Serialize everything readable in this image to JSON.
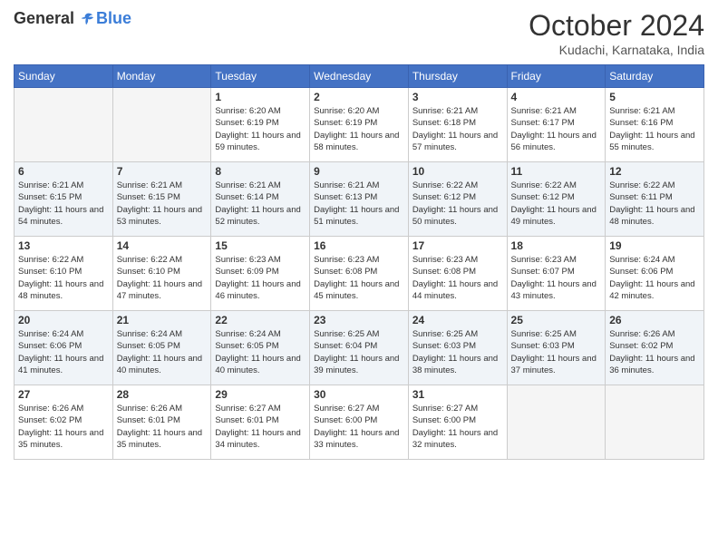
{
  "logo": {
    "general": "General",
    "blue": "Blue"
  },
  "header": {
    "month": "October 2024",
    "location": "Kudachi, Karnataka, India"
  },
  "weekdays": [
    "Sunday",
    "Monday",
    "Tuesday",
    "Wednesday",
    "Thursday",
    "Friday",
    "Saturday"
  ],
  "weeks": [
    [
      {
        "day": "",
        "sunrise": "",
        "sunset": "",
        "daylight": ""
      },
      {
        "day": "",
        "sunrise": "",
        "sunset": "",
        "daylight": ""
      },
      {
        "day": "1",
        "sunrise": "Sunrise: 6:20 AM",
        "sunset": "Sunset: 6:19 PM",
        "daylight": "Daylight: 11 hours and 59 minutes."
      },
      {
        "day": "2",
        "sunrise": "Sunrise: 6:20 AM",
        "sunset": "Sunset: 6:19 PM",
        "daylight": "Daylight: 11 hours and 58 minutes."
      },
      {
        "day": "3",
        "sunrise": "Sunrise: 6:21 AM",
        "sunset": "Sunset: 6:18 PM",
        "daylight": "Daylight: 11 hours and 57 minutes."
      },
      {
        "day": "4",
        "sunrise": "Sunrise: 6:21 AM",
        "sunset": "Sunset: 6:17 PM",
        "daylight": "Daylight: 11 hours and 56 minutes."
      },
      {
        "day": "5",
        "sunrise": "Sunrise: 6:21 AM",
        "sunset": "Sunset: 6:16 PM",
        "daylight": "Daylight: 11 hours and 55 minutes."
      }
    ],
    [
      {
        "day": "6",
        "sunrise": "Sunrise: 6:21 AM",
        "sunset": "Sunset: 6:15 PM",
        "daylight": "Daylight: 11 hours and 54 minutes."
      },
      {
        "day": "7",
        "sunrise": "Sunrise: 6:21 AM",
        "sunset": "Sunset: 6:15 PM",
        "daylight": "Daylight: 11 hours and 53 minutes."
      },
      {
        "day": "8",
        "sunrise": "Sunrise: 6:21 AM",
        "sunset": "Sunset: 6:14 PM",
        "daylight": "Daylight: 11 hours and 52 minutes."
      },
      {
        "day": "9",
        "sunrise": "Sunrise: 6:21 AM",
        "sunset": "Sunset: 6:13 PM",
        "daylight": "Daylight: 11 hours and 51 minutes."
      },
      {
        "day": "10",
        "sunrise": "Sunrise: 6:22 AM",
        "sunset": "Sunset: 6:12 PM",
        "daylight": "Daylight: 11 hours and 50 minutes."
      },
      {
        "day": "11",
        "sunrise": "Sunrise: 6:22 AM",
        "sunset": "Sunset: 6:12 PM",
        "daylight": "Daylight: 11 hours and 49 minutes."
      },
      {
        "day": "12",
        "sunrise": "Sunrise: 6:22 AM",
        "sunset": "Sunset: 6:11 PM",
        "daylight": "Daylight: 11 hours and 48 minutes."
      }
    ],
    [
      {
        "day": "13",
        "sunrise": "Sunrise: 6:22 AM",
        "sunset": "Sunset: 6:10 PM",
        "daylight": "Daylight: 11 hours and 48 minutes."
      },
      {
        "day": "14",
        "sunrise": "Sunrise: 6:22 AM",
        "sunset": "Sunset: 6:10 PM",
        "daylight": "Daylight: 11 hours and 47 minutes."
      },
      {
        "day": "15",
        "sunrise": "Sunrise: 6:23 AM",
        "sunset": "Sunset: 6:09 PM",
        "daylight": "Daylight: 11 hours and 46 minutes."
      },
      {
        "day": "16",
        "sunrise": "Sunrise: 6:23 AM",
        "sunset": "Sunset: 6:08 PM",
        "daylight": "Daylight: 11 hours and 45 minutes."
      },
      {
        "day": "17",
        "sunrise": "Sunrise: 6:23 AM",
        "sunset": "Sunset: 6:08 PM",
        "daylight": "Daylight: 11 hours and 44 minutes."
      },
      {
        "day": "18",
        "sunrise": "Sunrise: 6:23 AM",
        "sunset": "Sunset: 6:07 PM",
        "daylight": "Daylight: 11 hours and 43 minutes."
      },
      {
        "day": "19",
        "sunrise": "Sunrise: 6:24 AM",
        "sunset": "Sunset: 6:06 PM",
        "daylight": "Daylight: 11 hours and 42 minutes."
      }
    ],
    [
      {
        "day": "20",
        "sunrise": "Sunrise: 6:24 AM",
        "sunset": "Sunset: 6:06 PM",
        "daylight": "Daylight: 11 hours and 41 minutes."
      },
      {
        "day": "21",
        "sunrise": "Sunrise: 6:24 AM",
        "sunset": "Sunset: 6:05 PM",
        "daylight": "Daylight: 11 hours and 40 minutes."
      },
      {
        "day": "22",
        "sunrise": "Sunrise: 6:24 AM",
        "sunset": "Sunset: 6:05 PM",
        "daylight": "Daylight: 11 hours and 40 minutes."
      },
      {
        "day": "23",
        "sunrise": "Sunrise: 6:25 AM",
        "sunset": "Sunset: 6:04 PM",
        "daylight": "Daylight: 11 hours and 39 minutes."
      },
      {
        "day": "24",
        "sunrise": "Sunrise: 6:25 AM",
        "sunset": "Sunset: 6:03 PM",
        "daylight": "Daylight: 11 hours and 38 minutes."
      },
      {
        "day": "25",
        "sunrise": "Sunrise: 6:25 AM",
        "sunset": "Sunset: 6:03 PM",
        "daylight": "Daylight: 11 hours and 37 minutes."
      },
      {
        "day": "26",
        "sunrise": "Sunrise: 6:26 AM",
        "sunset": "Sunset: 6:02 PM",
        "daylight": "Daylight: 11 hours and 36 minutes."
      }
    ],
    [
      {
        "day": "27",
        "sunrise": "Sunrise: 6:26 AM",
        "sunset": "Sunset: 6:02 PM",
        "daylight": "Daylight: 11 hours and 35 minutes."
      },
      {
        "day": "28",
        "sunrise": "Sunrise: 6:26 AM",
        "sunset": "Sunset: 6:01 PM",
        "daylight": "Daylight: 11 hours and 35 minutes."
      },
      {
        "day": "29",
        "sunrise": "Sunrise: 6:27 AM",
        "sunset": "Sunset: 6:01 PM",
        "daylight": "Daylight: 11 hours and 34 minutes."
      },
      {
        "day": "30",
        "sunrise": "Sunrise: 6:27 AM",
        "sunset": "Sunset: 6:00 PM",
        "daylight": "Daylight: 11 hours and 33 minutes."
      },
      {
        "day": "31",
        "sunrise": "Sunrise: 6:27 AM",
        "sunset": "Sunset: 6:00 PM",
        "daylight": "Daylight: 11 hours and 32 minutes."
      },
      {
        "day": "",
        "sunrise": "",
        "sunset": "",
        "daylight": ""
      },
      {
        "day": "",
        "sunrise": "",
        "sunset": "",
        "daylight": ""
      }
    ]
  ]
}
